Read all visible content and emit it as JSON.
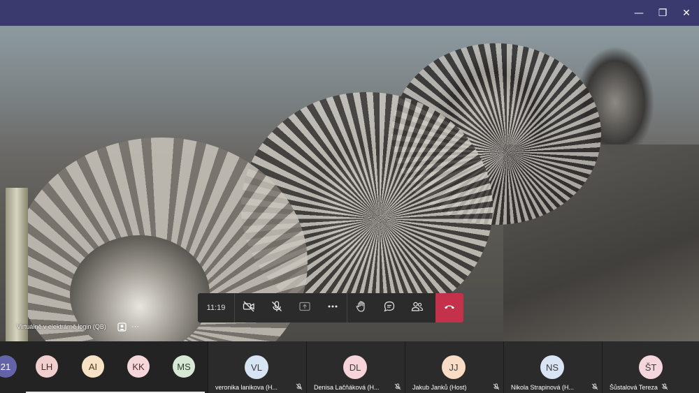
{
  "window": {
    "minimize_glyph": "—",
    "restore_glyph": "❐",
    "close_glyph": "✕"
  },
  "stage": {
    "shared_by": "Virtuálně v elektrárně login (QB)",
    "more_glyph": "···"
  },
  "call_bar": {
    "time": "11:19",
    "hangup_color": "#c4314b"
  },
  "roster_small": [
    {
      "initials": "21",
      "color": "#6264a7",
      "text_color": "#ffffff"
    },
    {
      "initials": "LH",
      "color": "#f2cfcf",
      "text_color": "#4a2b2b"
    },
    {
      "initials": "AI",
      "color": "#f7e2c6",
      "text_color": "#4a3a22"
    },
    {
      "initials": "KK",
      "color": "#f5d6d9",
      "text_color": "#4a2b2e"
    },
    {
      "initials": "MS",
      "color": "#d7e9d4",
      "text_color": "#2c3e2a"
    }
  ],
  "tiles": [
    {
      "initials": "VL",
      "name": "veronika lanikova (H...",
      "color": "#d6e4f4"
    },
    {
      "initials": "DL",
      "name": "Denisa Lačňáková (H...",
      "color": "#f6d4da"
    },
    {
      "initials": "JJ",
      "name": "Jakub Janků (Host)",
      "color": "#f8dcc6"
    },
    {
      "initials": "NS",
      "name": "Nikola Strapinová (H...",
      "color": "#d9e4f5"
    },
    {
      "initials": "ŠT",
      "name": "Šůstalová Tereza",
      "color": "#f5d6dc"
    }
  ]
}
